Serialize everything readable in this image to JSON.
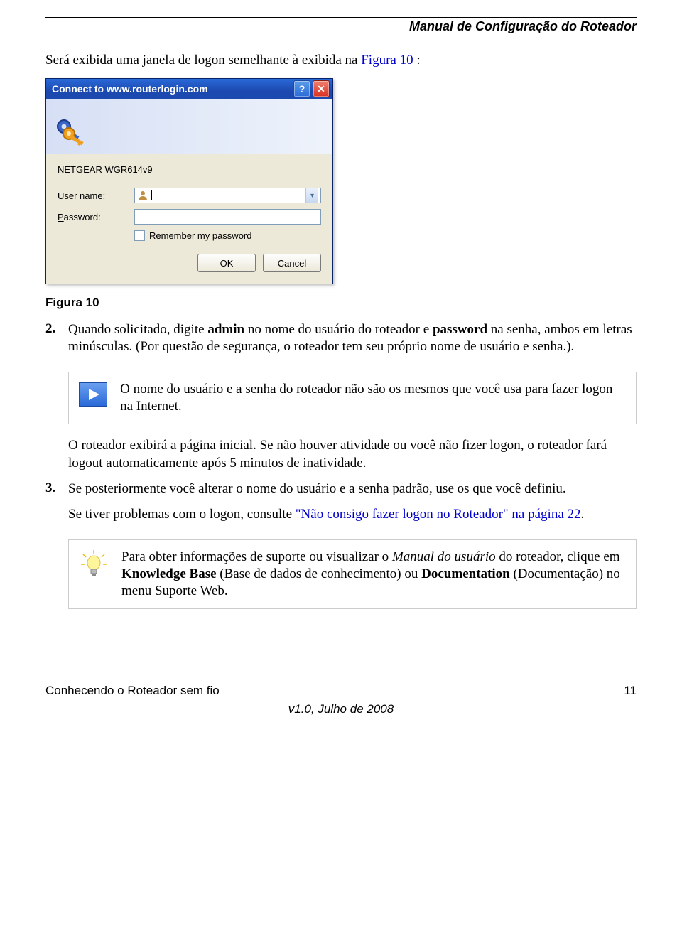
{
  "header": {
    "title": "Manual de Configuração do Roteador"
  },
  "intro": {
    "prefix": "Será exibida uma janela de logon semelhante à exibida na ",
    "figref": "Figura 10",
    "suffix": " :"
  },
  "dialog": {
    "title": "Connect to www.routerlogin.com",
    "device": "NETGEAR WGR614v9",
    "username_label_pre": "U",
    "username_label_rest": "ser name:",
    "password_label_pre": "P",
    "password_label_rest": "assword:",
    "remember_pre": "R",
    "remember_rest": "emember my password",
    "ok": "OK",
    "cancel": "Cancel"
  },
  "figure_caption": "Figura 10",
  "step2": {
    "num": "2.",
    "t1": "Quando solicitado, digite ",
    "admin": "admin",
    "t2": " no nome do usuário do roteador e ",
    "password": "password",
    "t3": " na senha, ambos em letras minúsculas. (Por questão de segurança, o roteador tem seu próprio nome de usuário e senha.)."
  },
  "note": "O nome do usuário e a senha do roteador não são os mesmos que você usa para fazer logon na Internet.",
  "after_note": "O roteador exibirá a página inicial. Se não houver atividade ou você não fizer logon, o roteador fará logout automaticamente após 5 minutos de inatividade.",
  "step3": {
    "num": "3.",
    "line1": "Se posteriormente você alterar o nome do usuário e a senha padrão, use os que você definiu.",
    "line2_pre": "Se tiver problemas com o logon, consulte ",
    "line2_link": "\"Não consigo fazer logon no Roteador\" na página 22",
    "line2_post": "."
  },
  "tip": {
    "t1": "Para obter informações de suporte ou visualizar o ",
    "manual": "Manual do usuário",
    "t2": " do roteador, clique em ",
    "kb": "Knowledge Base",
    "t3": " (Base de dados de conhecimento) ou ",
    "doc": "Documentation",
    "t4": " (Documentação) no menu Suporte Web."
  },
  "footer": {
    "left": "Conhecendo o Roteador sem fio",
    "right": "11",
    "version": "v1.0, Julho de 2008"
  }
}
